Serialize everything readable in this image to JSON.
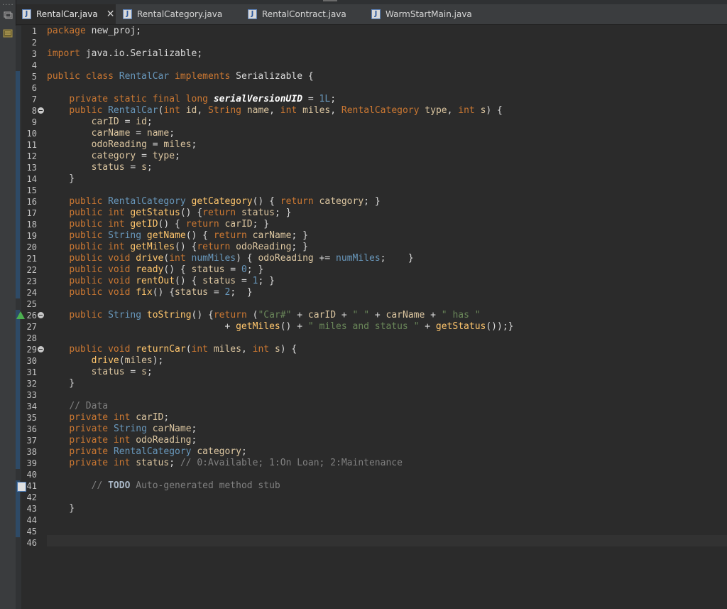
{
  "tabs": [
    {
      "label": "RentalCar.java",
      "active": true
    },
    {
      "label": "RentalCategory.java",
      "active": false
    },
    {
      "label": "RentalContract.java",
      "active": false
    },
    {
      "label": "WarmStartMain.java",
      "active": false
    }
  ],
  "tab_close_glyph": "✕",
  "code_lines": [
    {
      "n": "1",
      "tokens": [
        [
          "k",
          "package"
        ],
        [
          "p",
          " new_proj;"
        ]
      ]
    },
    {
      "n": "2",
      "tokens": []
    },
    {
      "n": "3",
      "tokens": [
        [
          "k",
          "import"
        ],
        [
          "p",
          " java.io.Serializable;"
        ]
      ]
    },
    {
      "n": "4",
      "tokens": []
    },
    {
      "n": "5",
      "tokens": [
        [
          "k",
          "public class "
        ],
        [
          "t",
          "RentalCar"
        ],
        [
          "k",
          " implements "
        ],
        [
          "p",
          "Serializable {"
        ]
      ]
    },
    {
      "n": "6",
      "tokens": []
    },
    {
      "n": "7",
      "tokens": [
        [
          "p",
          "    "
        ],
        [
          "k",
          "private static final long "
        ],
        [
          "sv",
          "serialVersionUID"
        ],
        [
          "p",
          " = "
        ],
        [
          "n",
          "1L"
        ],
        [
          "p",
          ";"
        ]
      ]
    },
    {
      "n": "8",
      "marker": "override",
      "tokens": [
        [
          "p",
          "    "
        ],
        [
          "k",
          "public "
        ],
        [
          "t",
          "RentalCar"
        ],
        [
          "p",
          "("
        ],
        [
          "k",
          "int "
        ],
        [
          "v",
          "id"
        ],
        [
          "p",
          ", "
        ],
        [
          "k",
          "String "
        ],
        [
          "v",
          "name"
        ],
        [
          "p",
          ", "
        ],
        [
          "k",
          "int "
        ],
        [
          "v",
          "miles"
        ],
        [
          "p",
          ", "
        ],
        [
          "k",
          "RentalCategory "
        ],
        [
          "v",
          "type"
        ],
        [
          "p",
          ", "
        ],
        [
          "k",
          "int "
        ],
        [
          "v",
          "s"
        ],
        [
          "p",
          ") {"
        ]
      ]
    },
    {
      "n": "9",
      "tokens": [
        [
          "p",
          "        "
        ],
        [
          "v",
          "carID"
        ],
        [
          "p",
          " = "
        ],
        [
          "v",
          "id"
        ],
        [
          "p",
          ";"
        ]
      ]
    },
    {
      "n": "10",
      "tokens": [
        [
          "p",
          "        "
        ],
        [
          "v",
          "carName"
        ],
        [
          "p",
          " = "
        ],
        [
          "v",
          "name"
        ],
        [
          "p",
          ";"
        ]
      ]
    },
    {
      "n": "11",
      "tokens": [
        [
          "p",
          "        "
        ],
        [
          "v",
          "odoReading"
        ],
        [
          "p",
          " = "
        ],
        [
          "v",
          "miles"
        ],
        [
          "p",
          ";"
        ]
      ]
    },
    {
      "n": "12",
      "tokens": [
        [
          "p",
          "        "
        ],
        [
          "v",
          "category"
        ],
        [
          "p",
          " = "
        ],
        [
          "v",
          "type"
        ],
        [
          "p",
          ";"
        ]
      ]
    },
    {
      "n": "13",
      "tokens": [
        [
          "p",
          "        "
        ],
        [
          "v",
          "status"
        ],
        [
          "p",
          " = "
        ],
        [
          "v",
          "s"
        ],
        [
          "p",
          ";"
        ]
      ]
    },
    {
      "n": "14",
      "tokens": [
        [
          "p",
          "    }"
        ]
      ]
    },
    {
      "n": "15",
      "tokens": []
    },
    {
      "n": "16",
      "tokens": [
        [
          "p",
          "    "
        ],
        [
          "k",
          "public "
        ],
        [
          "t",
          "RentalCategory "
        ],
        [
          "f",
          "getCategory"
        ],
        [
          "p",
          "() { "
        ],
        [
          "k",
          "return "
        ],
        [
          "v",
          "category"
        ],
        [
          "p",
          "; }"
        ]
      ]
    },
    {
      "n": "17",
      "tokens": [
        [
          "p",
          "    "
        ],
        [
          "k",
          "public int "
        ],
        [
          "f",
          "getStatus"
        ],
        [
          "p",
          "() {"
        ],
        [
          "k",
          "return "
        ],
        [
          "v",
          "status"
        ],
        [
          "p",
          "; }"
        ]
      ]
    },
    {
      "n": "18",
      "tokens": [
        [
          "p",
          "    "
        ],
        [
          "k",
          "public int "
        ],
        [
          "f",
          "getID"
        ],
        [
          "p",
          "() { "
        ],
        [
          "k",
          "return "
        ],
        [
          "v",
          "carID"
        ],
        [
          "p",
          "; }"
        ]
      ]
    },
    {
      "n": "19",
      "tokens": [
        [
          "p",
          "    "
        ],
        [
          "k",
          "public "
        ],
        [
          "t",
          "String "
        ],
        [
          "f",
          "getName"
        ],
        [
          "p",
          "() { "
        ],
        [
          "k",
          "return "
        ],
        [
          "v",
          "carName"
        ],
        [
          "p",
          "; }"
        ]
      ]
    },
    {
      "n": "20",
      "tokens": [
        [
          "p",
          "    "
        ],
        [
          "k",
          "public int "
        ],
        [
          "f",
          "getMiles"
        ],
        [
          "p",
          "() {"
        ],
        [
          "k",
          "return "
        ],
        [
          "v",
          "odoReading"
        ],
        [
          "p",
          "; }"
        ]
      ]
    },
    {
      "n": "21",
      "tokens": [
        [
          "p",
          "    "
        ],
        [
          "k",
          "public void "
        ],
        [
          "f",
          "drive"
        ],
        [
          "p",
          "("
        ],
        [
          "k",
          "int "
        ],
        [
          "t",
          "numMiles"
        ],
        [
          "p",
          ") { "
        ],
        [
          "v",
          "odoReading"
        ],
        [
          "p",
          " += "
        ],
        [
          "t",
          "numMiles"
        ],
        [
          "p",
          ";    }"
        ]
      ]
    },
    {
      "n": "22",
      "tokens": [
        [
          "p",
          "    "
        ],
        [
          "k",
          "public void "
        ],
        [
          "f",
          "ready"
        ],
        [
          "p",
          "() { "
        ],
        [
          "v",
          "status"
        ],
        [
          "p",
          " = "
        ],
        [
          "n",
          "0"
        ],
        [
          "p",
          "; }"
        ]
      ]
    },
    {
      "n": "23",
      "tokens": [
        [
          "p",
          "    "
        ],
        [
          "k",
          "public void "
        ],
        [
          "f",
          "rentOut"
        ],
        [
          "p",
          "() { "
        ],
        [
          "v",
          "status"
        ],
        [
          "p",
          " = "
        ],
        [
          "n",
          "1"
        ],
        [
          "p",
          "; }"
        ]
      ]
    },
    {
      "n": "24",
      "tokens": [
        [
          "p",
          "    "
        ],
        [
          "k",
          "public void "
        ],
        [
          "f",
          "fix"
        ],
        [
          "p",
          "() {"
        ],
        [
          "v",
          "status"
        ],
        [
          "p",
          " = "
        ],
        [
          "n",
          "2"
        ],
        [
          "p",
          ";  }"
        ]
      ]
    },
    {
      "n": "25",
      "tokens": []
    },
    {
      "n": "26",
      "marker": "override",
      "warn": true,
      "tokens": [
        [
          "p",
          "    "
        ],
        [
          "k",
          "public "
        ],
        [
          "t",
          "String "
        ],
        [
          "f",
          "toString"
        ],
        [
          "p",
          "() {"
        ],
        [
          "k",
          "return "
        ],
        [
          "p",
          "("
        ],
        [
          "s",
          "\"Car#\""
        ],
        [
          "p",
          " + "
        ],
        [
          "v",
          "carID"
        ],
        [
          "p",
          " + "
        ],
        [
          "s",
          "\" \""
        ],
        [
          "p",
          " + "
        ],
        [
          "v",
          "carName"
        ],
        [
          "p",
          " + "
        ],
        [
          "s",
          "\" has \""
        ]
      ]
    },
    {
      "n": "27",
      "tokens": [
        [
          "p",
          "                                + "
        ],
        [
          "f",
          "getMiles"
        ],
        [
          "p",
          "() + "
        ],
        [
          "s",
          "\" miles and status \""
        ],
        [
          "p",
          " + "
        ],
        [
          "f",
          "getStatus"
        ],
        [
          "p",
          "());}"
        ]
      ]
    },
    {
      "n": "28",
      "tokens": []
    },
    {
      "n": "29",
      "marker": "override",
      "tokens": [
        [
          "p",
          "    "
        ],
        [
          "k",
          "public void "
        ],
        [
          "f",
          "returnCar"
        ],
        [
          "p",
          "("
        ],
        [
          "k",
          "int "
        ],
        [
          "v",
          "miles"
        ],
        [
          "p",
          ", "
        ],
        [
          "k",
          "int "
        ],
        [
          "v",
          "s"
        ],
        [
          "p",
          ") {"
        ]
      ]
    },
    {
      "n": "30",
      "tokens": [
        [
          "p",
          "        "
        ],
        [
          "f",
          "drive"
        ],
        [
          "p",
          "("
        ],
        [
          "v",
          "miles"
        ],
        [
          "p",
          ");"
        ]
      ]
    },
    {
      "n": "31",
      "tokens": [
        [
          "p",
          "        "
        ],
        [
          "v",
          "status"
        ],
        [
          "p",
          " = "
        ],
        [
          "v",
          "s"
        ],
        [
          "p",
          ";"
        ]
      ]
    },
    {
      "n": "32",
      "tokens": [
        [
          "p",
          "    }"
        ]
      ]
    },
    {
      "n": "33",
      "tokens": []
    },
    {
      "n": "34",
      "tokens": [
        [
          "p",
          "    "
        ],
        [
          "c",
          "// Data"
        ]
      ]
    },
    {
      "n": "35",
      "tokens": [
        [
          "p",
          "    "
        ],
        [
          "k",
          "private int "
        ],
        [
          "v",
          "carID"
        ],
        [
          "p",
          ";"
        ]
      ]
    },
    {
      "n": "36",
      "tokens": [
        [
          "p",
          "    "
        ],
        [
          "k",
          "private "
        ],
        [
          "t",
          "String "
        ],
        [
          "v",
          "carName"
        ],
        [
          "p",
          ";"
        ]
      ]
    },
    {
      "n": "37",
      "tokens": [
        [
          "p",
          "    "
        ],
        [
          "k",
          "private int "
        ],
        [
          "v",
          "odoReading"
        ],
        [
          "p",
          ";"
        ]
      ]
    },
    {
      "n": "38",
      "tokens": [
        [
          "p",
          "    "
        ],
        [
          "k",
          "private "
        ],
        [
          "t",
          "RentalCategory "
        ],
        [
          "v",
          "category"
        ],
        [
          "p",
          ";"
        ]
      ]
    },
    {
      "n": "39",
      "tokens": [
        [
          "p",
          "    "
        ],
        [
          "k",
          "private int "
        ],
        [
          "v",
          "status"
        ],
        [
          "p",
          "; "
        ],
        [
          "c",
          "// 0:Available; 1:On Loan; 2:Maintenance"
        ]
      ]
    },
    {
      "n": "40",
      "tokens": []
    },
    {
      "n": "41",
      "task": true,
      "tokens": [
        [
          "p",
          "        "
        ],
        [
          "c",
          "// "
        ],
        [
          "todo",
          "TODO"
        ],
        [
          "c",
          " Auto-generated method stub"
        ]
      ]
    },
    {
      "n": "42",
      "tokens": []
    },
    {
      "n": "43",
      "tokens": [
        [
          "p",
          "    }"
        ]
      ]
    },
    {
      "n": "44",
      "tokens": []
    },
    {
      "n": "45",
      "tokens": []
    },
    {
      "n": "46",
      "tokens": []
    }
  ]
}
